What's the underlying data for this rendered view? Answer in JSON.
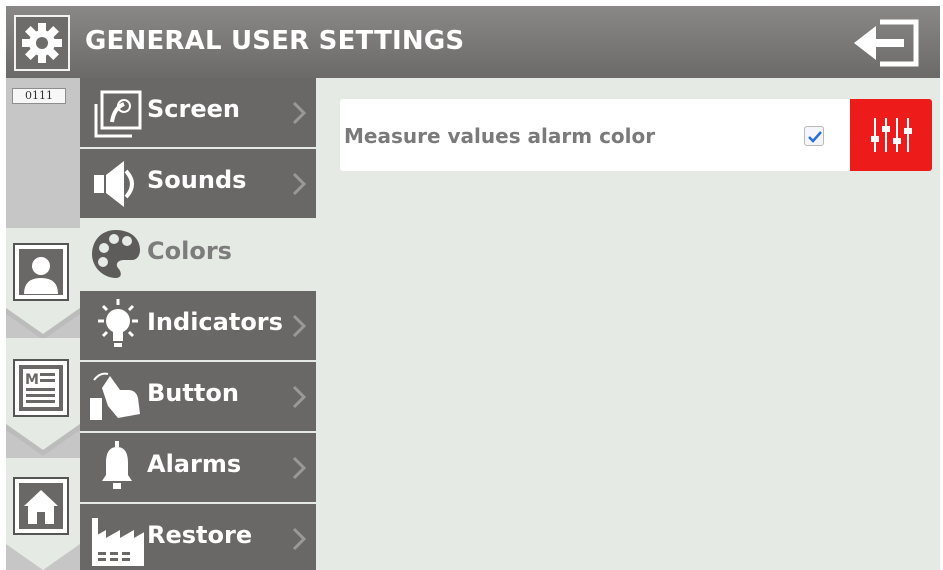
{
  "header": {
    "title": "GENERAL USER SETTINGS",
    "icon": "gear-icon",
    "exit_icon": "exit-icon"
  },
  "rail": {
    "code": "0111",
    "buttons": [
      "user-icon",
      "menu-list-icon",
      "home-icon"
    ]
  },
  "menu": {
    "items": [
      {
        "label": "Screen",
        "icon": "screen-icon",
        "active": false
      },
      {
        "label": "Sounds",
        "icon": "speaker-icon",
        "active": false
      },
      {
        "label": "Colors",
        "icon": "palette-icon",
        "active": true
      },
      {
        "label": "Indicators",
        "icon": "bulb-icon",
        "active": false
      },
      {
        "label": "Button",
        "icon": "hand-pointer-icon",
        "active": false
      },
      {
        "label": "Alarms",
        "icon": "bell-icon",
        "active": false
      },
      {
        "label": "Restore",
        "icon": "factory-icon",
        "active": false
      }
    ]
  },
  "content": {
    "setting_label": "Measure values alarm color",
    "checked": true,
    "color_button_color": "#ee1b1b",
    "color_button_icon": "sliders-icon"
  },
  "colors": {
    "header": "#767373",
    "menu": "#6a6767",
    "background": "#e6eae5",
    "accent": "#ee1b1b"
  }
}
